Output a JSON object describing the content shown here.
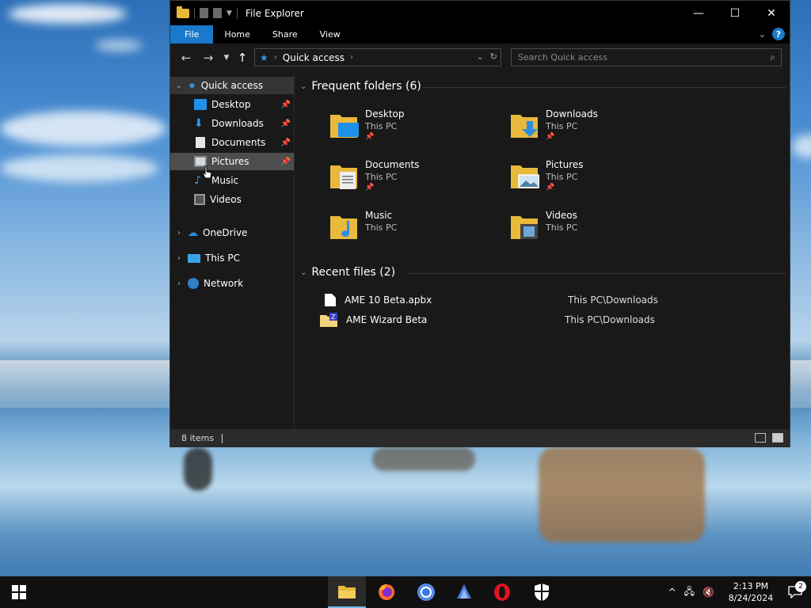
{
  "window": {
    "title": "File Explorer",
    "controls": {
      "minimize": "—",
      "maximize": "☐",
      "close": "✕"
    }
  },
  "ribbon": {
    "tabs": [
      "File",
      "Home",
      "Share",
      "View"
    ],
    "help": "?"
  },
  "address": {
    "path": "Quick access",
    "search_placeholder": "Search Quick access"
  },
  "nav": {
    "quick_access": "Quick access",
    "items": [
      {
        "label": "Desktop",
        "icon": "desktop-icon"
      },
      {
        "label": "Downloads",
        "icon": "downloads-icon"
      },
      {
        "label": "Documents",
        "icon": "documents-icon"
      },
      {
        "label": "Pictures",
        "icon": "pictures-icon"
      },
      {
        "label": "Music",
        "icon": "music-icon"
      },
      {
        "label": "Videos",
        "icon": "videos-icon"
      }
    ],
    "onedrive": "OneDrive",
    "this_pc": "This PC",
    "network": "Network"
  },
  "frequent": {
    "header": "Frequent folders (6)",
    "folders": [
      {
        "name": "Desktop",
        "location": "This PC",
        "pinned": true
      },
      {
        "name": "Downloads",
        "location": "This PC",
        "pinned": true
      },
      {
        "name": "Documents",
        "location": "This PC",
        "pinned": true
      },
      {
        "name": "Pictures",
        "location": "This PC",
        "pinned": true
      },
      {
        "name": "Music",
        "location": "This PC",
        "pinned": false
      },
      {
        "name": "Videos",
        "location": "This PC",
        "pinned": false
      }
    ]
  },
  "recent": {
    "header": "Recent files (2)",
    "files": [
      {
        "name": "AME 10 Beta.apbx",
        "path": "This PC\\Downloads"
      },
      {
        "name": "AME Wizard Beta",
        "path": "This PC\\Downloads"
      }
    ]
  },
  "status": {
    "items": "8 items"
  },
  "taskbar": {
    "apps": [
      "file-explorer-icon",
      "firefox-icon",
      "chrome-icon",
      "app-icon",
      "opera-icon",
      "security-icon"
    ],
    "time": "2:13 PM",
    "date": "8/24/2024",
    "notifications": "2"
  },
  "colors": {
    "accent": "#1979ca",
    "folder": "#e8b93a",
    "bg": "#191919"
  }
}
